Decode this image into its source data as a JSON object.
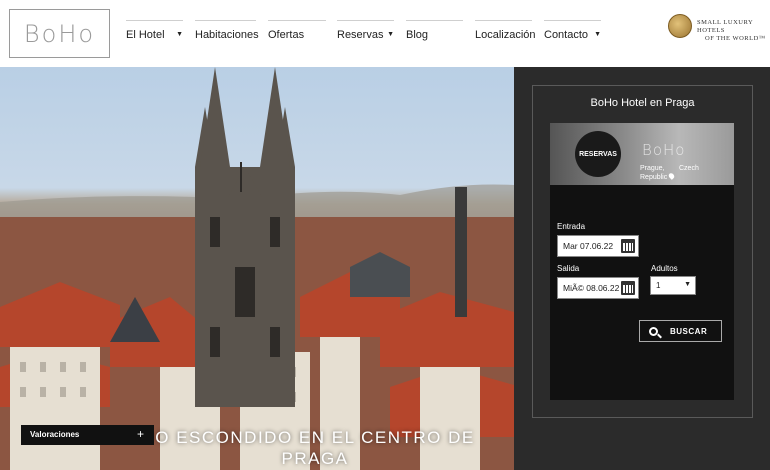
{
  "header": {
    "logo_text": "BoHo",
    "nav": [
      {
        "label": "El Hotel",
        "has_caret": true
      },
      {
        "label": "Habitaciones",
        "has_caret": false
      },
      {
        "label": "Ofertas",
        "has_caret": false
      },
      {
        "label": "Reservas",
        "has_caret": true
      },
      {
        "label": "Blog",
        "has_caret": false
      },
      {
        "label": "Localización",
        "has_caret": false
      },
      {
        "label": "Contacto",
        "has_caret": true
      }
    ],
    "partner_line1": "Small Luxury Hotels",
    "partner_line2": "of the World™"
  },
  "hero": {
    "caption_line1": "O ESCONDIDO EN EL CENTRO DE",
    "caption_line2": "PRAGA",
    "ratings_label": "Valoraciones",
    "ratings_toggle": "+"
  },
  "booking": {
    "title": "BoHo Hotel en Praga",
    "badge": "RESERVAS",
    "banner_logo": "BoHo",
    "banner_city": "Prague,",
    "banner_country": "Czech",
    "banner_country2": "Republic",
    "checkin_label": "Entrada",
    "checkin_value": "Mar 07.06.22",
    "checkout_label": "Salida",
    "checkout_value": "MiÃ© 08.06.22",
    "adults_label": "Adultos",
    "adults_value": "1",
    "search_label": "BUSCAR"
  },
  "colors": {
    "sidebar_bg": "#2b2b2b",
    "booking_bg": "#111111",
    "nav_text": "#222222"
  }
}
